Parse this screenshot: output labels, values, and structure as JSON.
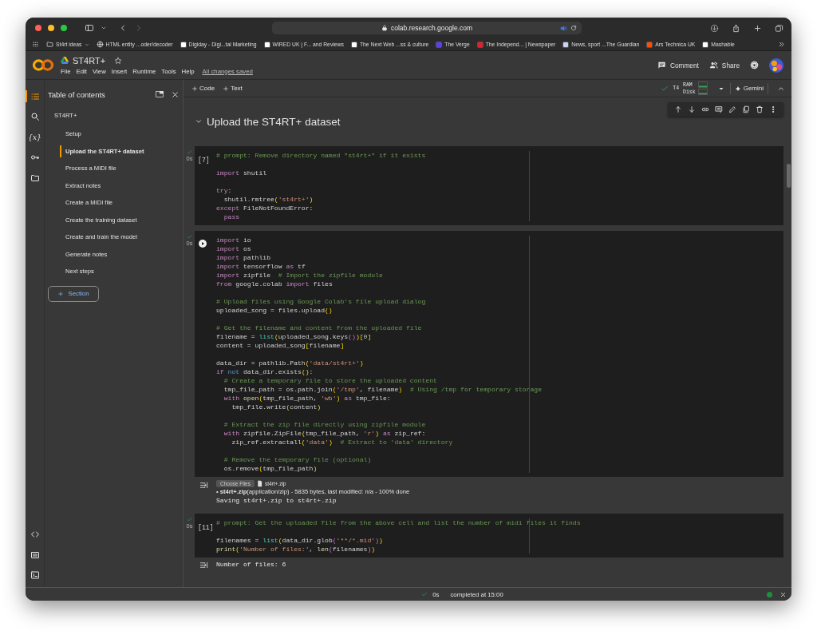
{
  "browser": {
    "url": "colab.research.google.com",
    "bookmarks": [
      {
        "kind": "folder",
        "label": "St4rt ideas"
      },
      {
        "kind": "globe",
        "label": "HTML entity ...oder/decoder"
      },
      {
        "kind": "site",
        "label": "Digiday - Digi...tal Marketing",
        "color": "#ffffff"
      },
      {
        "kind": "site",
        "label": "WIRED UK | F... and Reviews",
        "color": "#ffffff"
      },
      {
        "kind": "site",
        "label": "The Next Web ...ss & culture",
        "color": "#ffffff"
      },
      {
        "kind": "site",
        "label": "The Verge",
        "color": "#5b3df5"
      },
      {
        "kind": "site",
        "label": "The Independ... | Newspaper",
        "color": "#e0202a"
      },
      {
        "kind": "site",
        "label": "News, sport ...The Guardian",
        "color": "#c9d4f0"
      },
      {
        "kind": "site",
        "label": "Ars Technica UK",
        "color": "#ff4e00"
      },
      {
        "kind": "site",
        "label": "Mashable",
        "color": "#ffffff"
      }
    ]
  },
  "app": {
    "title": "ST4RT+",
    "menu": [
      "File",
      "Edit",
      "View",
      "Insert",
      "Runtime",
      "Tools",
      "Help"
    ],
    "save_status": "All changes saved",
    "actions": [
      {
        "kind": "comment",
        "label": "Comment"
      },
      {
        "kind": "people",
        "label": "Share"
      }
    ]
  },
  "rail": {
    "top": [
      {
        "kind": "toc",
        "selected": true
      },
      {
        "kind": "search",
        "selected": false
      },
      {
        "kind": "variables",
        "glyph": "{x}",
        "selected": false
      },
      {
        "kind": "key",
        "selected": false
      },
      {
        "kind": "folder",
        "selected": false
      }
    ],
    "bottom": [
      {
        "kind": "code"
      },
      {
        "kind": "keyboard"
      },
      {
        "kind": "terminal"
      }
    ]
  },
  "sidebar": {
    "title": "Table of contents",
    "toc": [
      {
        "label": "ST4RT+",
        "selected": false,
        "children": [
          {
            "label": "Setup",
            "selected": false
          },
          {
            "label": "Upload the ST4RT+ dataset",
            "selected": true
          },
          {
            "label": "Process a MIDI file",
            "selected": false
          },
          {
            "label": "Extract notes",
            "selected": false
          },
          {
            "label": "Create a MIDI file",
            "selected": false
          },
          {
            "label": "Create the training dataset",
            "selected": false
          },
          {
            "label": "Create and train the model",
            "selected": false
          },
          {
            "label": "Generate notes",
            "selected": false
          },
          {
            "label": "Next steps",
            "selected": false
          }
        ]
      }
    ],
    "add_button": "Section"
  },
  "notebook": {
    "toolbar": {
      "add": [
        "Code",
        "Text"
      ],
      "runtime": {
        "connected": true,
        "accelerator": "T4",
        "ram_label": "RAM",
        "disk_label": "Disk"
      },
      "gemini": "Gemini"
    },
    "section": {
      "title": "Upload the ST4RT+ dataset",
      "expanded": true
    },
    "cells": [
      {
        "gutter": {
          "kind": "count",
          "text": "[7]"
        },
        "done": true,
        "status": "0s",
        "code": [
          [
            [
              {
                "kind": "cm",
                "text": "# prompt: Remove directory named \"st4rt+\" if it exists"
              }
            ]
          ],
          [
            [
              {
                "kind": "kw",
                "text": "import"
              },
              {
                "kind": "tx",
                "text": " shutil"
              }
            ]
          ],
          [
            [
              {
                "kind": "kw",
                "text": "try"
              },
              {
                "kind": "tx",
                "text": ":"
              }
            ],
            [
              {
                "kind": "tx",
                "text": "  shutil.rmtree"
              },
              {
                "kind": "br",
                "text": "("
              },
              {
                "kind": "str",
                "text": "'st4rt+'"
              },
              {
                "kind": "br",
                "text": ")"
              }
            ],
            [
              {
                "kind": "kw",
                "text": "except"
              },
              {
                "kind": "tx",
                "text": " FileNotFoundError:"
              }
            ],
            [
              {
                "kind": "kw",
                "text": "  pass"
              }
            ]
          ]
        ]
      },
      {
        "gutter": {
          "kind": "run"
        },
        "done": true,
        "status": "0s",
        "code": [
          [
            [
              {
                "kind": "kw",
                "text": "import"
              },
              {
                "kind": "tx",
                "text": " io"
              }
            ],
            [
              {
                "kind": "kw",
                "text": "import"
              },
              {
                "kind": "tx",
                "text": " os"
              }
            ],
            [
              {
                "kind": "kw",
                "text": "import"
              },
              {
                "kind": "tx",
                "text": " pathlib"
              }
            ],
            [
              {
                "kind": "kw",
                "text": "import"
              },
              {
                "kind": "tx",
                "text": " tensorflow "
              },
              {
                "kind": "kw",
                "text": "as"
              },
              {
                "kind": "tx",
                "text": " tf"
              }
            ],
            [
              {
                "kind": "kw",
                "text": "import"
              },
              {
                "kind": "tx",
                "text": " zipfile  "
              },
              {
                "kind": "cm",
                "text": "# Import the zipfile module"
              }
            ],
            [
              {
                "kind": "kw",
                "text": "from"
              },
              {
                "kind": "tx",
                "text": " google.colab "
              },
              {
                "kind": "kw",
                "text": "import"
              },
              {
                "kind": "tx",
                "text": " files"
              }
            ]
          ],
          [
            [
              {
                "kind": "cm",
                "text": "# Upload files using Google Colab's file upload dialog"
              }
            ],
            [
              {
                "kind": "tx",
                "text": "uploaded_song = files.upload"
              },
              {
                "kind": "br",
                "text": "()"
              }
            ]
          ],
          [
            [
              {
                "kind": "cm",
                "text": "# Get the filename and content from the uploaded file"
              }
            ],
            [
              {
                "kind": "tx",
                "text": "filename = "
              },
              {
                "kind": "bi",
                "text": "list"
              },
              {
                "kind": "br",
                "text": "("
              },
              {
                "kind": "tx",
                "text": "uploaded_song.keys"
              },
              {
                "kind": "br2",
                "text": "()"
              },
              {
                "kind": "br",
                "text": ")["
              },
              {
                "kind": "num",
                "text": "0"
              },
              {
                "kind": "br",
                "text": "]"
              }
            ],
            [
              {
                "kind": "tx",
                "text": "content = uploaded_song"
              },
              {
                "kind": "br",
                "text": "["
              },
              {
                "kind": "tx",
                "text": "filename"
              },
              {
                "kind": "br",
                "text": "]"
              }
            ]
          ],
          [
            [
              {
                "kind": "tx",
                "text": "data_dir = pathlib.Path"
              },
              {
                "kind": "br",
                "text": "("
              },
              {
                "kind": "str",
                "text": "'data/st4rt+'"
              },
              {
                "kind": "br",
                "text": ")"
              }
            ],
            [
              {
                "kind": "kw",
                "text": "if "
              },
              {
                "kind": "op",
                "text": "not"
              },
              {
                "kind": "tx",
                "text": " data_dir.exists"
              },
              {
                "kind": "br",
                "text": "()"
              },
              {
                "kind": "tx",
                "text": ":"
              }
            ],
            [
              {
                "kind": "cm",
                "text": "  # Create a temporary file to store the uploaded content"
              }
            ],
            [
              {
                "kind": "tx",
                "text": "  tmp_file_path = os.path.join"
              },
              {
                "kind": "br",
                "text": "("
              },
              {
                "kind": "str",
                "text": "'/tmp'"
              },
              {
                "kind": "tx",
                "text": ", filename"
              },
              {
                "kind": "br",
                "text": ")"
              },
              {
                "kind": "cm",
                "text": "  # Using /tmp for temporary storage"
              }
            ],
            [
              {
                "kind": "kw",
                "text": "  with "
              },
              {
                "kind": "fn",
                "text": "open"
              },
              {
                "kind": "br",
                "text": "("
              },
              {
                "kind": "tx",
                "text": "tmp_file_path, "
              },
              {
                "kind": "str",
                "text": "'wb'"
              },
              {
                "kind": "br",
                "text": ") "
              },
              {
                "kind": "kw",
                "text": "as"
              },
              {
                "kind": "tx",
                "text": " tmp_file:"
              }
            ],
            [
              {
                "kind": "tx",
                "text": "    tmp_file.write"
              },
              {
                "kind": "br",
                "text": "("
              },
              {
                "kind": "tx",
                "text": "content"
              },
              {
                "kind": "br",
                "text": ")"
              }
            ]
          ],
          [
            [
              {
                "kind": "cm",
                "text": "  # Extract the zip file directly using zipfile module"
              }
            ],
            [
              {
                "kind": "kw",
                "text": "  with"
              },
              {
                "kind": "tx",
                "text": " zipfile.ZipFile"
              },
              {
                "kind": "br",
                "text": "("
              },
              {
                "kind": "tx",
                "text": "tmp_file_path, "
              },
              {
                "kind": "str",
                "text": "'r'"
              },
              {
                "kind": "br",
                "text": ") "
              },
              {
                "kind": "kw",
                "text": "as"
              },
              {
                "kind": "tx",
                "text": " zip_ref:"
              }
            ],
            [
              {
                "kind": "tx",
                "text": "    zip_ref.extractall"
              },
              {
                "kind": "br",
                "text": "("
              },
              {
                "kind": "str",
                "text": "'data'"
              },
              {
                "kind": "br",
                "text": ")"
              },
              {
                "kind": "cm",
                "text": "  # Extract to 'data' directory"
              }
            ]
          ],
          [
            [
              {
                "kind": "cm",
                "text": "  # Remove the temporary file (optional)"
              }
            ],
            [
              {
                "kind": "tx",
                "text": "  os.remove"
              },
              {
                "kind": "br",
                "text": "("
              },
              {
                "kind": "tx",
                "text": "tmp_file_path"
              },
              {
                "kind": "br",
                "text": ")"
              }
            ]
          ]
        ],
        "output": {
          "kind": "upload",
          "button": "Choose Files",
          "disabled": true,
          "file": "st4rt+.zip",
          "summary": "•  **st4rt+.zip**(application/zip) - 5835 bytes, last modified: n/a - 100% done",
          "log": "Saving st4rt+.zip to st4rt+.zip"
        }
      },
      {
        "gutter": {
          "kind": "count",
          "text": "[11]"
        },
        "done": true,
        "status": "0s",
        "code": [
          [
            [
              {
                "kind": "cm",
                "text": "# prompt: Get the uploaded file from the above cell and list the number of midi files it finds"
              }
            ]
          ],
          [
            [
              {
                "kind": "tx",
                "text": "filenames = "
              },
              {
                "kind": "bi",
                "text": "list"
              },
              {
                "kind": "br",
                "text": "("
              },
              {
                "kind": "tx",
                "text": "data_dir.glob"
              },
              {
                "kind": "br2",
                "text": "("
              },
              {
                "kind": "str",
                "text": "'**/*.mid'"
              },
              {
                "kind": "br2",
                "text": ")"
              },
              {
                "kind": "br",
                "text": ")"
              }
            ],
            [
              {
                "kind": "fn",
                "text": "print"
              },
              {
                "kind": "br",
                "text": "("
              },
              {
                "kind": "str",
                "text": "'Number of files:'"
              },
              {
                "kind": "tx",
                "text": ", "
              },
              {
                "kind": "fn",
                "text": "len"
              },
              {
                "kind": "br2",
                "text": "("
              },
              {
                "kind": "tx",
                "text": "filenames"
              },
              {
                "kind": "br2",
                "text": ")"
              },
              {
                "kind": "br",
                "text": ")"
              }
            ]
          ]
        ],
        "output": {
          "kind": "text",
          "text": "Number of files: 6"
        }
      }
    ]
  },
  "status_bar": {
    "elapsed": "0s",
    "message": "completed at 15:00",
    "connected": true
  }
}
